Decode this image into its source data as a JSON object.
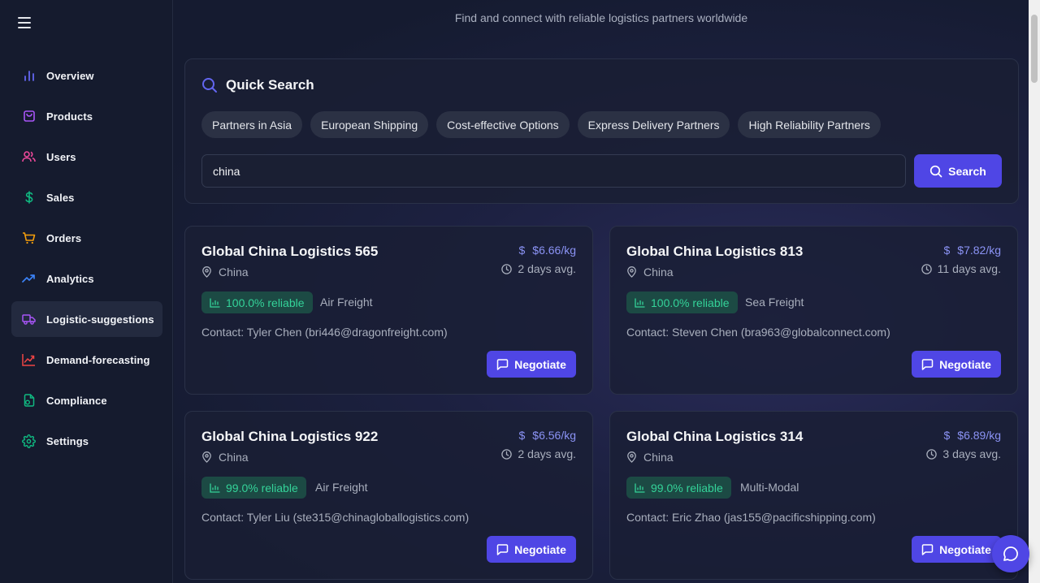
{
  "sidebar": {
    "items": [
      {
        "label": "Overview",
        "icon": "bar-chart-icon",
        "color": "#6366f1",
        "active": false
      },
      {
        "label": "Products",
        "icon": "bag-icon",
        "color": "#a855f7",
        "active": false
      },
      {
        "label": "Users",
        "icon": "users-icon",
        "color": "#ec4899",
        "active": false
      },
      {
        "label": "Sales",
        "icon": "dollar-icon",
        "color": "#10b981",
        "active": false
      },
      {
        "label": "Orders",
        "icon": "cart-icon",
        "color": "#f59e0b",
        "active": false
      },
      {
        "label": "Analytics",
        "icon": "trending-up-icon",
        "color": "#3b82f6",
        "active": false
      },
      {
        "label": "Logistic-suggestions",
        "icon": "truck-icon",
        "color": "#a855f7",
        "active": true
      },
      {
        "label": "Demand-forecasting",
        "icon": "trend-chart-icon",
        "color": "#ef4444",
        "active": false
      },
      {
        "label": "Compliance",
        "icon": "file-check-icon",
        "color": "#10b981",
        "active": false
      },
      {
        "label": "Settings",
        "icon": "gear-icon",
        "color": "#10b981",
        "active": false
      }
    ]
  },
  "main": {
    "subtitle": "Find and connect with reliable logistics partners worldwide"
  },
  "quick_search": {
    "title": "Quick Search",
    "chips": [
      "Partners in Asia",
      "European Shipping",
      "Cost-effective Options",
      "Express Delivery Partners",
      "High Reliability Partners"
    ],
    "input_value": "china",
    "button_label": "Search"
  },
  "cards": [
    {
      "name": "Global China Logistics 565",
      "location": "China",
      "price": "$6.66/kg",
      "eta": "2 days avg.",
      "reliability": "100.0% reliable",
      "mode": "Air Freight",
      "contact": "Contact: Tyler Chen (bri446@dragonfreight.com)",
      "button": "Negotiate"
    },
    {
      "name": "Global China Logistics 813",
      "location": "China",
      "price": "$7.82/kg",
      "eta": "11 days avg.",
      "reliability": "100.0% reliable",
      "mode": "Sea Freight",
      "contact": "Contact: Steven Chen (bra963@globalconnect.com)",
      "button": "Negotiate"
    },
    {
      "name": "Global China Logistics 922",
      "location": "China",
      "price": "$6.56/kg",
      "eta": "2 days avg.",
      "reliability": "99.0% reliable",
      "mode": "Air Freight",
      "contact": "Contact: Tyler Liu (ste315@chinagloballogistics.com)",
      "button": "Negotiate"
    },
    {
      "name": "Global China Logistics 314",
      "location": "China",
      "price": "$6.89/kg",
      "eta": "3 days avg.",
      "reliability": "99.0% reliable",
      "mode": "Multi-Modal",
      "contact": "Contact: Eric Zhao (jas155@pacificshipping.com)",
      "button": "Negotiate"
    }
  ],
  "colors": {
    "accent": "#4f46e5",
    "reliable_text": "#34d399",
    "price_text": "#8b93f5"
  }
}
